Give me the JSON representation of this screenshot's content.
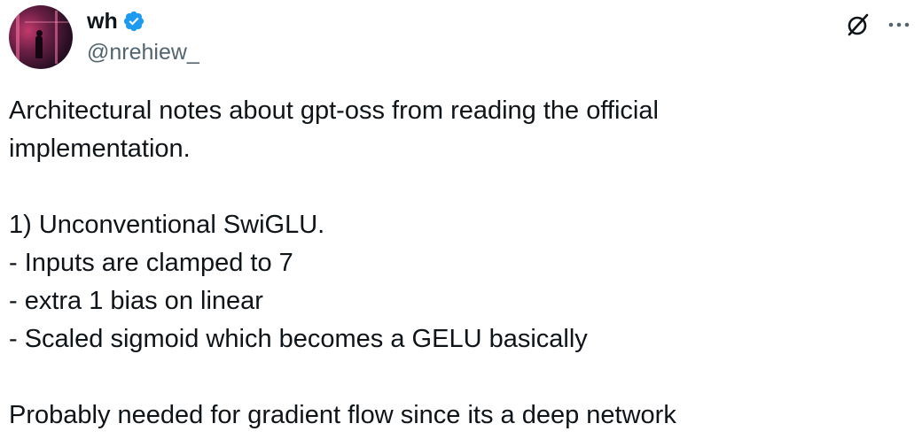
{
  "author": {
    "name": "wh",
    "handle": "@nrehiew_",
    "verified": true,
    "verified_color": "#1d9bf0"
  },
  "header_icons": {
    "grok": "grok-icon",
    "more": "more-options-icon"
  },
  "tweet": {
    "lines": [
      "Architectural notes about gpt-oss from reading the official",
      "implementation.",
      "",
      "1) Unconventional SwiGLU.",
      "- Inputs are clamped to 7",
      "- extra 1 bias on linear",
      "- Scaled sigmoid which becomes a GELU basically",
      "",
      "Probably needed for gradient flow since its a deep network"
    ]
  }
}
